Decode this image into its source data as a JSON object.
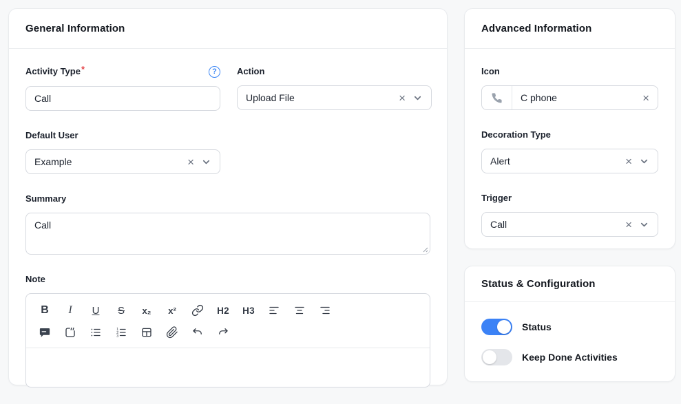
{
  "colors": {
    "accent_blue": "#3b82f6",
    "danger_red": "#e5484d",
    "icon_gray": "#6a7280",
    "page_background": "#f7f8f9"
  },
  "icons": {
    "help_glyph": "?",
    "clear_glyph": "×"
  },
  "general_card": {
    "title": "General Information",
    "activity_type": {
      "label": "Activity Type",
      "required_mark": "*",
      "value": "Call"
    },
    "action": {
      "label": "Action",
      "value": "Upload File"
    },
    "default_user": {
      "label": "Default User",
      "value": "Example"
    },
    "summary": {
      "label": "Summary",
      "value": "Call"
    },
    "note": {
      "label": "Note",
      "value": "",
      "toolbar_glyphs": {
        "bold": "B",
        "italic": "I",
        "underline": "U",
        "strikethrough": "S",
        "subscript": "x₂",
        "superscript": "x²",
        "h2": "H2",
        "h3": "H3"
      },
      "toolbar_row1": [
        "bold",
        "italic",
        "underline",
        "strikethrough",
        "subscript",
        "superscript",
        "link",
        "h2",
        "h3",
        "align-left",
        "align-center",
        "align-right"
      ],
      "toolbar_row2": [
        "comment",
        "blockquote",
        "bullet-list",
        "ordered-list",
        "table",
        "attachment",
        "undo",
        "redo"
      ]
    }
  },
  "advanced_card": {
    "title": "Advanced Information",
    "icon": {
      "label": "Icon",
      "value": "C phone",
      "icon_name": "phone-icon"
    },
    "decoration_type": {
      "label": "Decoration Type",
      "value": "Alert"
    },
    "trigger": {
      "label": "Trigger",
      "value": "Call"
    }
  },
  "status_card": {
    "title": "Status & Configuration",
    "toggles": [
      {
        "label": "Status",
        "on": true
      },
      {
        "label": "Keep Done Activities",
        "on": false
      }
    ]
  }
}
